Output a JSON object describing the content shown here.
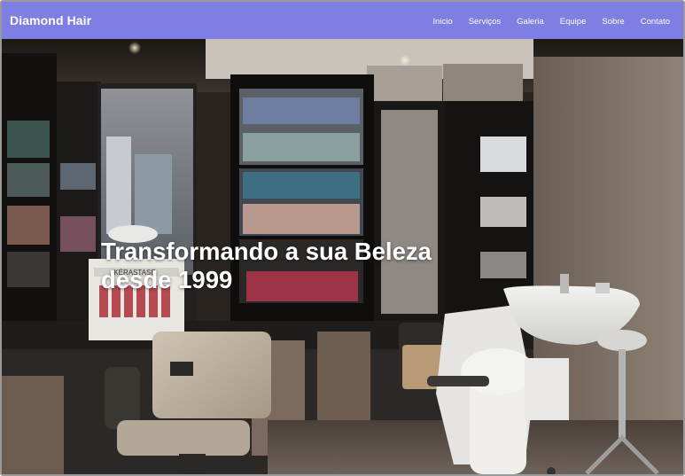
{
  "navbar": {
    "brand": "Diamond Hair",
    "links": [
      {
        "label": "Inicio"
      },
      {
        "label": "Serviços"
      },
      {
        "label": "Galeria"
      },
      {
        "label": "Equipe"
      },
      {
        "label": "Sobre"
      },
      {
        "label": "Contato"
      }
    ]
  },
  "hero": {
    "title_line1": "Transformando a sua Beleza",
    "title_line2": "desde 1999",
    "image_description_icon": "salon-interior-image",
    "shelf_brand": "KÉRASTASE"
  },
  "colors": {
    "navbar_bg": "#7f7fe3",
    "nav_text": "#ffffff",
    "hero_text": "#ffffff"
  }
}
